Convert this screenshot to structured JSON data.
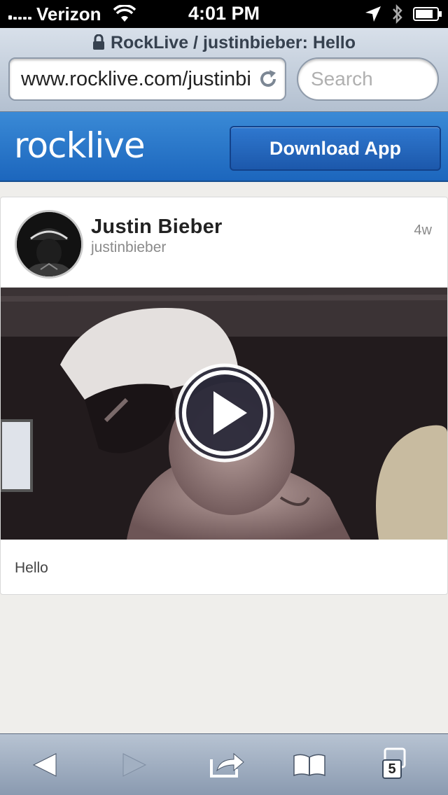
{
  "status_bar": {
    "carrier": "Verizon",
    "time": "4:01 PM"
  },
  "browser": {
    "page_title": "RockLive / justinbieber: Hello",
    "url": "www.rocklive.com/justinbieber",
    "search_placeholder": "Search",
    "tab_count": "5"
  },
  "site_header": {
    "logo_text": "rocklive",
    "download_button_label": "Download App",
    "brand_color": "#1f6cc2"
  },
  "post": {
    "author_name": "Justin Bieber",
    "author_handle": "justinbieber",
    "time_ago": "4w",
    "caption": "Hello"
  },
  "icons": {
    "status": [
      "signal-icon",
      "wifi-icon",
      "location-icon",
      "bluetooth-icon",
      "battery-icon"
    ],
    "browser": [
      "lock-icon",
      "reload-icon"
    ],
    "video": [
      "play-icon"
    ],
    "toolbar": [
      "back-icon",
      "forward-icon",
      "share-icon",
      "bookmarks-icon",
      "tabs-icon"
    ]
  }
}
